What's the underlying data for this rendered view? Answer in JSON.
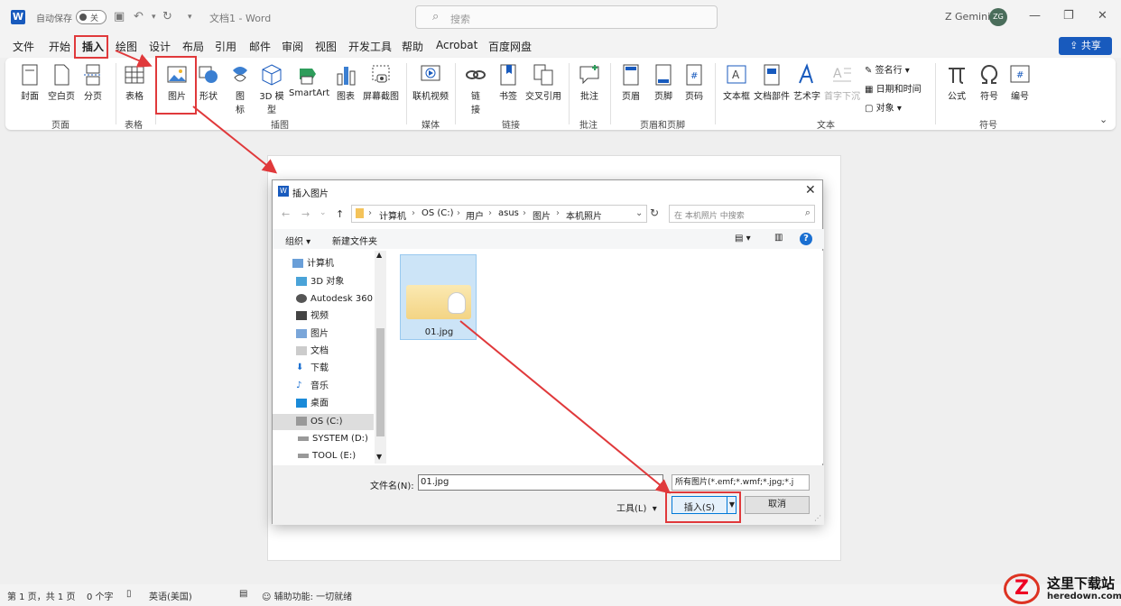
{
  "titlebar": {
    "autosave_label": "自动保存",
    "autosave_state": "关",
    "doc_title": "文档1  -  Word",
    "search_placeholder": "搜索",
    "user_name": "Z Gemini",
    "user_initials": "ZG"
  },
  "tabs": [
    "文件",
    "开始",
    "插入",
    "绘图",
    "设计",
    "布局",
    "引用",
    "邮件",
    "审阅",
    "视图",
    "开发工具",
    "帮助",
    "Acrobat",
    "百度网盘"
  ],
  "active_tab": "插入",
  "share_label": "共享",
  "ribbon": {
    "pages": {
      "cover": "封面",
      "blank": "空白页",
      "break": "分页",
      "group": "页面"
    },
    "tables": {
      "table": "表格",
      "group": "表格"
    },
    "illustrations": {
      "picture": "图片",
      "shapes": "形状",
      "icons": "图",
      "icons2": "标",
      "model3d": "3D 模",
      "model3d2": "型",
      "smartart": "SmartArt",
      "chart": "图表",
      "screenshot": "屏幕截图",
      "group": "插图"
    },
    "media": {
      "online_video": "联机视频",
      "group": "媒体"
    },
    "links": {
      "link": "链",
      "link2": "接",
      "bookmark": "书签",
      "crossref": "交叉引用",
      "group": "链接"
    },
    "comments": {
      "comment": "批注",
      "group": "批注"
    },
    "header_footer": {
      "header": "页眉",
      "footer": "页脚",
      "page_number": "页码",
      "group": "页眉和页脚"
    },
    "text": {
      "textbox": "文本框",
      "quickparts": "文档部件",
      "wordart": "艺术字",
      "dropcap": "首字下沉",
      "signature": "签名行",
      "datetime": "日期和时间",
      "object": "对象",
      "group": "文本"
    },
    "symbols": {
      "equation": "公式",
      "symbol": "符号",
      "number": "编号",
      "group": "符号"
    }
  },
  "dialog": {
    "title": "插入图片",
    "breadcrumbs": [
      "计算机",
      "OS (C:)",
      "用户",
      "asus",
      "图片",
      "本机照片"
    ],
    "search_placeholder": "在 本机照片 中搜索",
    "organize": "组织 ▾",
    "new_folder": "新建文件夹",
    "nav_items": [
      "计算机",
      "3D 对象",
      "Autodesk 360",
      "视频",
      "图片",
      "文档",
      "下载",
      "音乐",
      "桌面",
      "OS (C:)",
      "SYSTEM (D:)",
      "TOOL (E:)"
    ],
    "selected_nav": "OS (C:)",
    "files": [
      {
        "name": "01.jpg"
      }
    ],
    "filename_label": "文件名(N):",
    "filename_value": "01.jpg",
    "filetype_value": "所有图片(*.emf;*.wmf;*.jpg;*.j",
    "tools_label": "工具(L)",
    "insert_label": "插入(S)",
    "cancel_label": "取消"
  },
  "statusbar": {
    "page": "第 1 页，共 1 页",
    "words": "0 个字",
    "language": "英语(美国)",
    "accessibility": "辅助功能: 一切就绪"
  },
  "watermark": {
    "cn": "这里下载站",
    "en": "heredown.com"
  },
  "colors": {
    "accent": "#185abd",
    "annotation": "#e0393b"
  }
}
